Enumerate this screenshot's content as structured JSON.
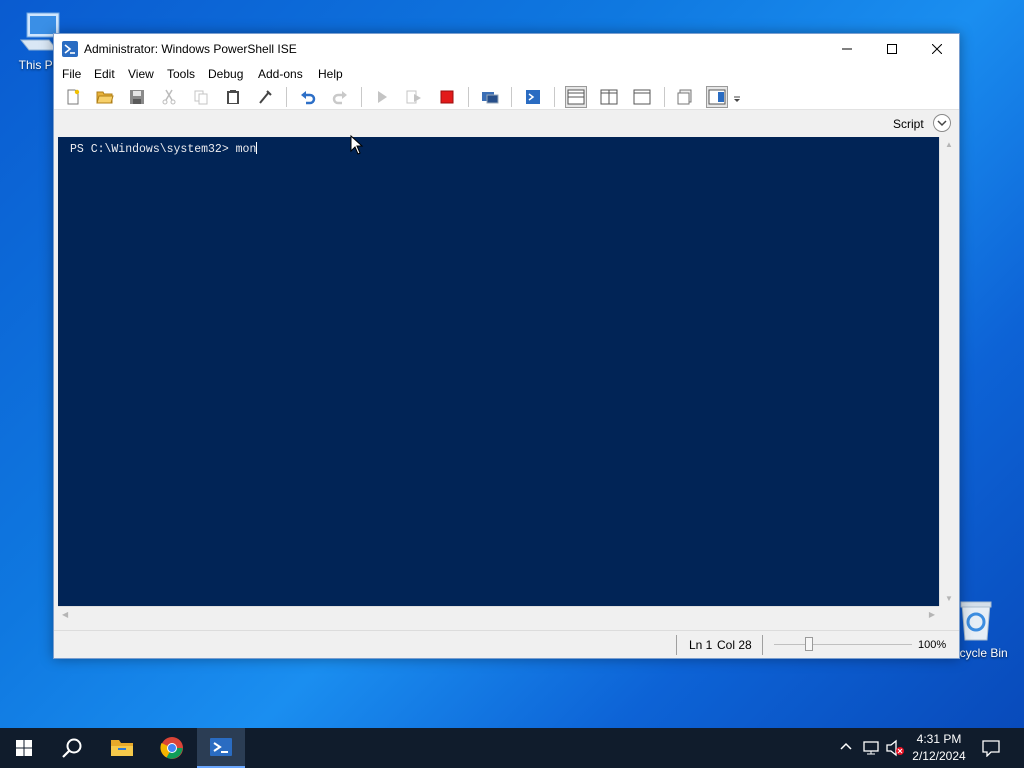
{
  "desktop": {
    "icons": [
      {
        "label": "This PC",
        "icon": "computer-icon"
      },
      {
        "label": "Recycle Bin",
        "icon": "recycle-bin-icon"
      }
    ]
  },
  "window": {
    "title": "Administrator: Windows PowerShell ISE",
    "icon": "powershell-ise-icon",
    "controls": [
      "minimize-icon",
      "maximize-icon",
      "close-icon"
    ]
  },
  "menu": {
    "items": [
      "File",
      "Edit",
      "View",
      "Tools",
      "Debug",
      "Add-ons",
      "Help"
    ]
  },
  "toolbar": {
    "buttons": [
      "new-script-icon",
      "open-icon",
      "save-icon",
      "cut-icon",
      "copy-icon",
      "paste-icon",
      "clear-console-icon",
      "undo-icon",
      "redo-icon",
      "run-script-icon",
      "run-selection-icon",
      "stop-operation-icon",
      "new-remote-powershell-tab-icon",
      "start-powershell-exe-icon",
      "show-script-pane-top-icon",
      "show-script-pane-right-icon",
      "show-script-pane-maximized-icon",
      "show-command-window-icon",
      "show-command-addon-icon",
      "toolbar-overflow-icon"
    ]
  },
  "scriptbar": {
    "label": "Script"
  },
  "console": {
    "prompt": "PS C:\\Windows\\system32> ",
    "input": "mon"
  },
  "statusbar": {
    "ln": "Ln 1",
    "col": "Col 28",
    "zoom_label": "100%",
    "zoom_level": 0.25
  },
  "taskbar": {
    "items": [
      "start-icon",
      "search-icon",
      "file-explorer-icon",
      "chrome-icon",
      "powershell-ise-icon"
    ],
    "tray": [
      "show-hidden-icons-icon",
      "network-icon",
      "volume-muted-icon",
      "action-center-icon"
    ],
    "time": "4:31 PM",
    "date": "2/12/2024"
  },
  "colors": {
    "console_bg": "#012456",
    "console_text": "#eeedf0",
    "desktop_blue": "#0f78e0",
    "taskbar_bg": "#101c2c"
  }
}
